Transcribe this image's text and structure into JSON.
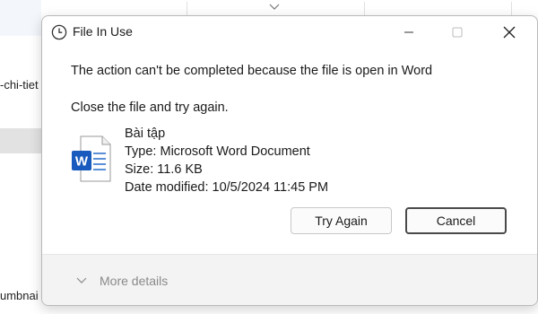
{
  "background": {
    "left_text_1": "-chi-tiet",
    "left_text_2": "umbnai"
  },
  "dialog": {
    "title": "File In Use",
    "message": "The action can't be completed because the file is open in Word",
    "instruction": "Close the file and try again.",
    "file": {
      "name": "Bài tập",
      "type_line": "Type: Microsoft Word Document",
      "size_line": "Size: 11.6 KB",
      "date_line": "Date modified: 10/5/2024 11:45 PM",
      "icon": "word-document-icon"
    },
    "buttons": {
      "try_again": "Try Again",
      "cancel": "Cancel"
    },
    "more_details": "More details",
    "window_controls": [
      "minimize-icon",
      "maximize-icon",
      "close-icon"
    ]
  },
  "colors": {
    "word_blue": "#185abd",
    "dialog_border": "#b9b9b9",
    "footer_bg": "#f3f3f3"
  }
}
